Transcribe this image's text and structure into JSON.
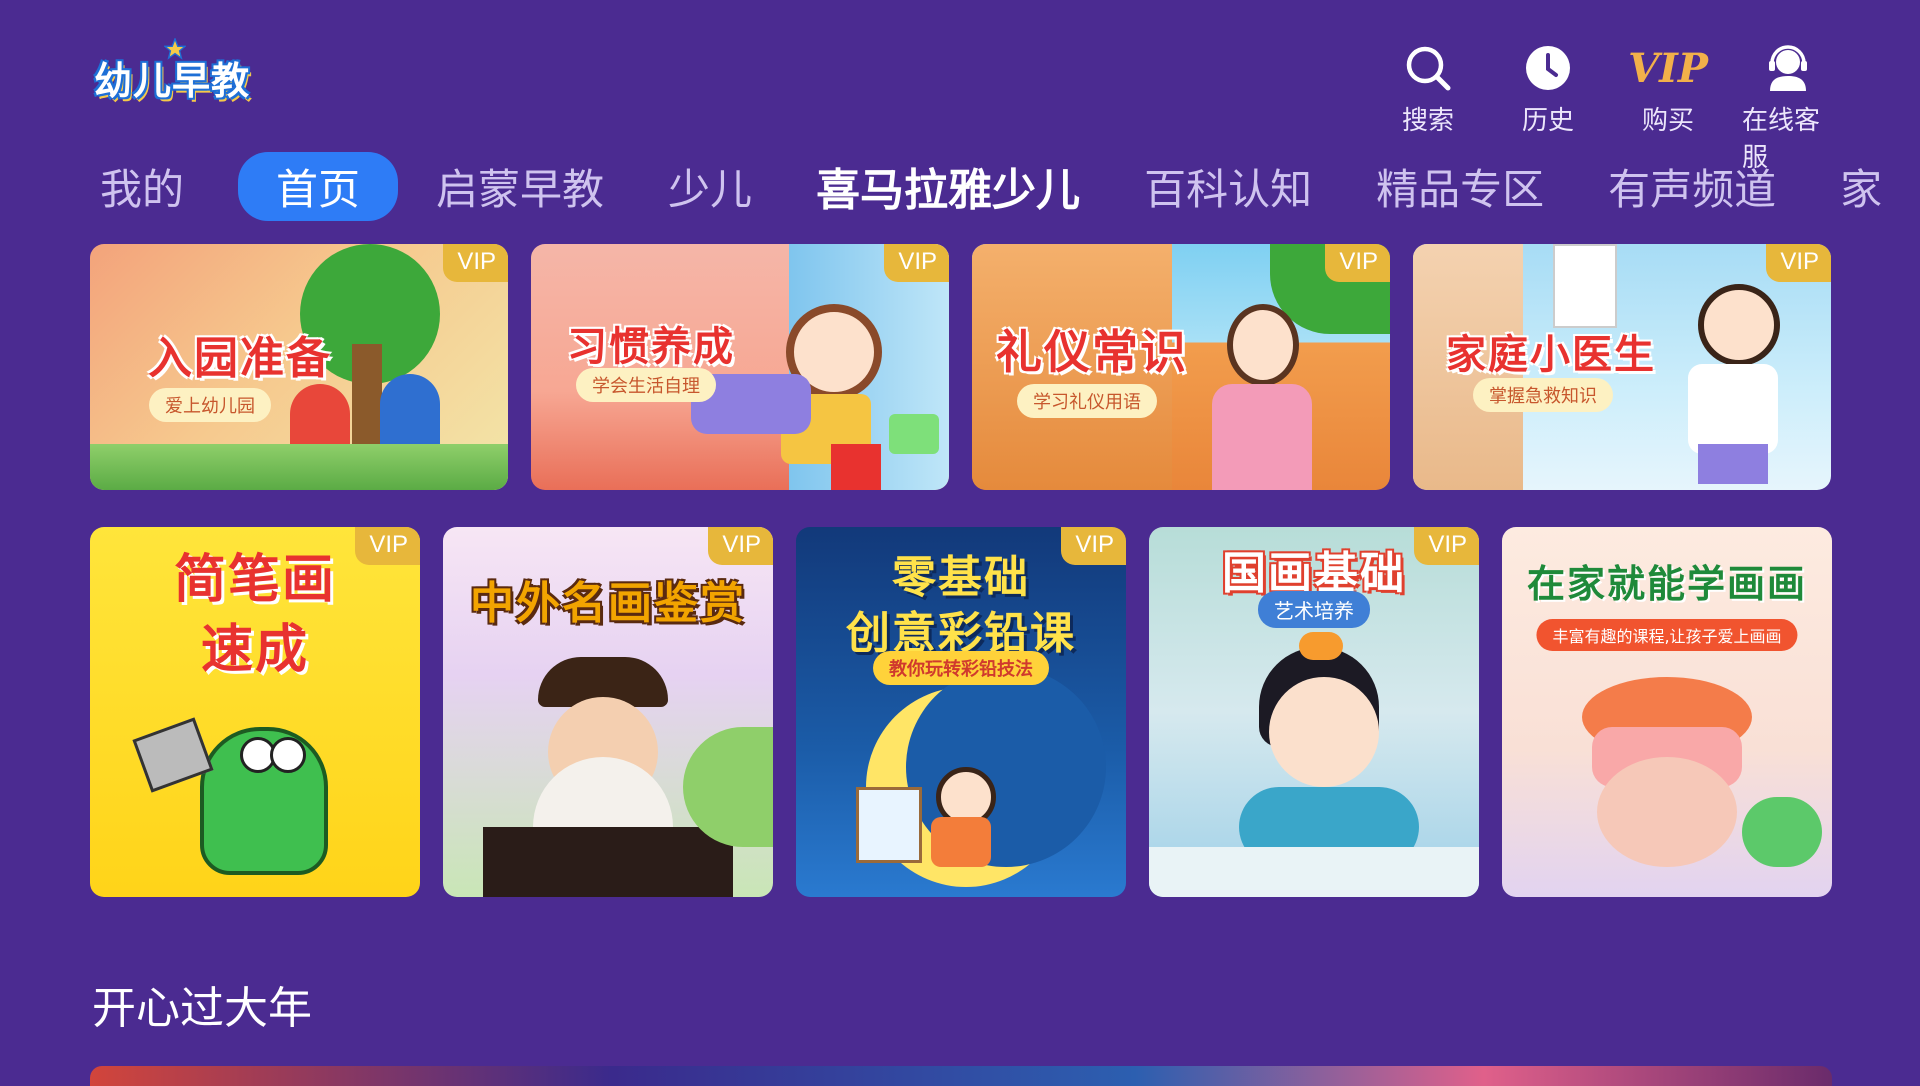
{
  "app": {
    "logo_text": "幼儿早教"
  },
  "header_actions": [
    {
      "label": "搜索",
      "icon": "search-icon"
    },
    {
      "label": "历史",
      "icon": "clock-icon"
    },
    {
      "label": "购买",
      "icon": "vip-icon",
      "icon_text": "VIP"
    },
    {
      "label": "在线客服",
      "icon": "support-icon"
    }
  ],
  "tabs": [
    {
      "label": "我的"
    },
    {
      "label": "首页",
      "active": true
    },
    {
      "label": "启蒙早教"
    },
    {
      "label": "少儿"
    },
    {
      "label": "喜马拉雅少儿",
      "brand": true
    },
    {
      "label": "百科认知"
    },
    {
      "label": "精品专区"
    },
    {
      "label": "有声频道"
    },
    {
      "label": "家"
    }
  ],
  "vip_badge": "VIP",
  "row1": [
    {
      "title": "入园准备",
      "subtitle": "爱上幼儿园",
      "vip": true
    },
    {
      "title": "习惯养成",
      "subtitle": "学会生活自理",
      "vip": true
    },
    {
      "title": "礼仪常识",
      "subtitle": "学习礼仪用语",
      "vip": true
    },
    {
      "title": "家庭小医生",
      "subtitle": "掌握急救知识",
      "vip": true
    }
  ],
  "row2": [
    {
      "title": "简笔画速成",
      "title_l1": "简笔画",
      "title_l2": "速成",
      "vip": true
    },
    {
      "title": "中外名画鉴赏",
      "vip": true
    },
    {
      "title": "零基础创意彩铅课",
      "title_l1": "零基础",
      "title_l2": "创意彩铅课",
      "subtitle": "教你玩转彩铅技法",
      "vip": true
    },
    {
      "title": "国画基础",
      "subtitle": "艺术培养",
      "vip": true
    },
    {
      "title": "在家就能学画画",
      "subtitle": "丰富有趣的课程,让孩子爱上画画",
      "vip": false
    }
  ],
  "section": {
    "title": "开心过大年"
  },
  "colors": {
    "background": "#4b2b91",
    "active_tab": "#2e7cf6",
    "vip_gold": "#e7b73b"
  }
}
